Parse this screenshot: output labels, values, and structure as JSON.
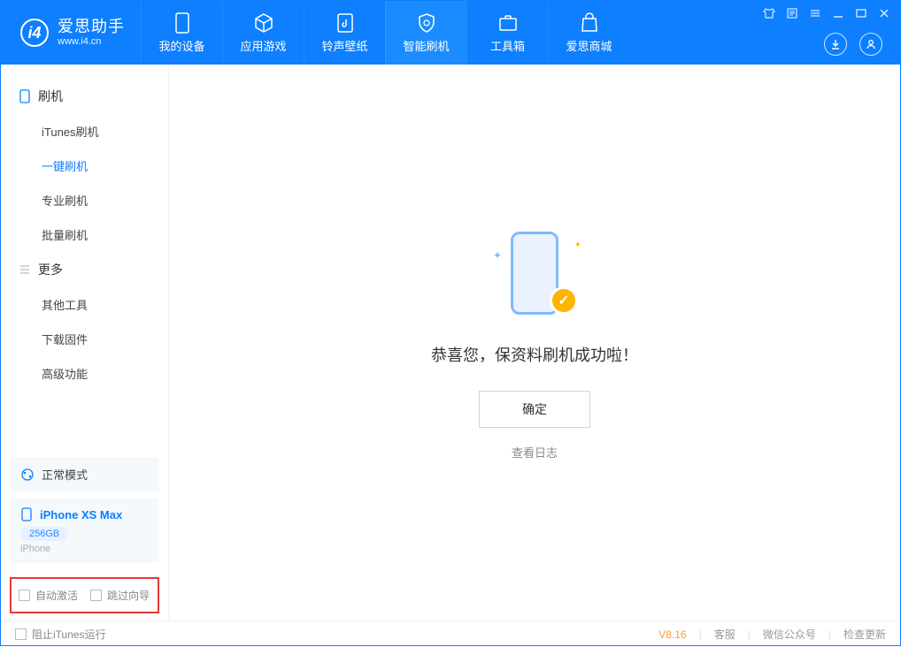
{
  "app": {
    "title": "爱思助手",
    "subtitle": "www.i4.cn"
  },
  "nav": {
    "items": [
      {
        "label": "我的设备"
      },
      {
        "label": "应用游戏"
      },
      {
        "label": "铃声壁纸"
      },
      {
        "label": "智能刷机"
      },
      {
        "label": "工具箱"
      },
      {
        "label": "爱思商城"
      }
    ]
  },
  "sidebar": {
    "section1_title": "刷机",
    "section1_items": [
      "iTunes刷机",
      "一键刷机",
      "专业刷机",
      "批量刷机"
    ],
    "section2_title": "更多",
    "section2_items": [
      "其他工具",
      "下载固件",
      "高级功能"
    ],
    "mode_label": "正常模式",
    "device_name": "iPhone XS Max",
    "device_storage": "256GB",
    "device_type": "iPhone",
    "checkbox1": "自动激活",
    "checkbox2": "跳过向导"
  },
  "main": {
    "success_text": "恭喜您，保资料刷机成功啦！",
    "ok_button": "确定",
    "log_link": "查看日志"
  },
  "footer": {
    "stop_itunes": "阻止iTunes运行",
    "version": "V8.16",
    "support": "客服",
    "wechat": "微信公众号",
    "update": "检查更新"
  }
}
